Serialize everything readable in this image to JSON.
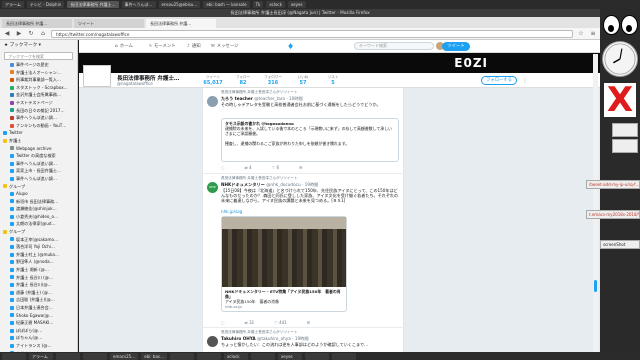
{
  "taskbar_top": [
    "アラーム",
    "テレビ - Dolphin",
    "長田法律事務所 弁護士…",
    "事件へうんぽ…",
    "ensou25@ebisu…",
    "ebi: bash — konsole",
    "Tk",
    "xclock",
    "xeyes"
  ],
  "taskbar_bottom": [
    "",
    "アラーム",
    "",
    "",
    "emacs25…",
    "ebi: bas…",
    "",
    "",
    "xclock",
    "",
    "xeyes",
    "",
    ""
  ],
  "window_title": "長田法律事務所 弁護士長田淳 (@Nagata Jun) | Twitter - Mozilla Firefox",
  "tabs": [
    "長田法律事務所 弁護…",
    "ツイート",
    "長田法律事務所 弁護…"
  ],
  "url": "https://twitter.com/nagatalawoffice",
  "sidebar": {
    "header": "ブックマーク",
    "search_placeholder": "ブックマークを検索",
    "items": [
      {
        "label": "事件ページの歴史",
        "depth": 1,
        "color": "#4a90d9"
      },
      {
        "label": "弁護士法人オーシャン…",
        "depth": 1,
        "color": "#e67e22"
      },
      {
        "label": "刑事裁判事業部一覧入…",
        "depth": 1,
        "color": "#d35400"
      },
      {
        "label": "ネタストック - Scrapbox…",
        "depth": 1,
        "color": "#27ae60"
      },
      {
        "label": "金沢弁護士会所属事務…",
        "depth": 1,
        "color": "#2980b9"
      },
      {
        "label": "テストテストページ",
        "depth": 1,
        "color": "#8e44ad"
      },
      {
        "label": "長田の日々の雑記 2017…",
        "depth": 1,
        "color": "#16a085"
      },
      {
        "label": "事件へうんぽ追い調…",
        "depth": 1,
        "color": "#c0392b"
      },
      {
        "label": "ナンキンもの動画 - YouT…",
        "depth": 1,
        "color": "#e74c3c"
      },
      {
        "label": "Twitter",
        "depth": 0,
        "color": "#1da1f2"
      },
      {
        "label": "弁護士",
        "depth": 0,
        "color": "#f1c40f"
      },
      {
        "label": "Webpage archive",
        "depth": 1,
        "color": "#7f8c8d"
      },
      {
        "label": "Twitter の高度な検索",
        "depth": 1,
        "color": "#1da1f2"
      },
      {
        "label": "事件へうんぽ追い調…",
        "depth": 1,
        "color": "#1da1f2"
      },
      {
        "label": "実家上市 - 長田弁護士…",
        "depth": 1,
        "color": "#1da1f2"
      },
      {
        "label": "事件へうんぽ追い調…",
        "depth": 1,
        "color": "#1da1f2"
      },
      {
        "label": "グループ",
        "depth": 0,
        "color": "#f1c40f"
      },
      {
        "label": "Alupo",
        "depth": 1,
        "color": "#1da1f2"
      },
      {
        "label": "新垣市 長田法律事務…",
        "depth": 1,
        "color": "#1da1f2"
      },
      {
        "label": "渡瀬綾佳(@shinjuk…",
        "depth": 1,
        "color": "#1da1f2"
      },
      {
        "label": "小倉秀夫(@hideo_o…",
        "depth": 1,
        "color": "#1da1f2"
      },
      {
        "label": "太朗の法律家(@ud…",
        "depth": 1,
        "color": "#1da1f2"
      },
      {
        "label": "グループ",
        "depth": 0,
        "color": "#f1c40f"
      },
      {
        "label": "坂本正幸(@sakamo…",
        "depth": 1,
        "color": "#1da1f2"
      },
      {
        "label": "落合洋司 Yoji Ochi…",
        "depth": 1,
        "color": "#1da1f2"
      },
      {
        "label": "弁護士村上 (@muka…",
        "depth": 1,
        "color": "#1da1f2"
      },
      {
        "label": "野田隼人 (@noda…",
        "depth": 1,
        "color": "#1da1f2"
      },
      {
        "label": "弁護士 堀新 (@…",
        "depth": 1,
        "color": "#1da1f2"
      },
      {
        "label": "弁護士 長谷川 (@…",
        "depth": 1,
        "color": "#1da1f2"
      },
      {
        "label": "弁護士 長谷川(@…",
        "depth": 1,
        "color": "#1da1f2"
      },
      {
        "label": "遠藤 (弁護士) (@…",
        "depth": 1,
        "color": "#1da1f2"
      },
      {
        "label": "吉田聡 (弁護士)(@…",
        "depth": 1,
        "color": "#1da1f2"
      },
      {
        "label": "日本弁護士連合会…",
        "depth": 1,
        "color": "#1da1f2"
      },
      {
        "label": "Shoko Egawa(@…",
        "depth": 1,
        "color": "#1da1f2"
      },
      {
        "label": "紀藤正樹 MASAKI…",
        "depth": 1,
        "color": "#1da1f2"
      },
      {
        "label": "ぽぽぽら(@…",
        "depth": 1,
        "color": "#1da1f2"
      },
      {
        "label": "ぽちゃん(@…",
        "depth": 1,
        "color": "#1da1f2"
      },
      {
        "label": "ナイトランス (@…",
        "depth": 1,
        "color": "#1da1f2"
      },
      {
        "label": "小林よしのり(@…",
        "depth": 1,
        "color": "#1da1f2"
      },
      {
        "label": "森中(@TAKAUS…",
        "depth": 1,
        "color": "#1da1f2"
      },
      {
        "label": "弁護士 (@…",
        "depth": 1,
        "color": "#1da1f2"
      }
    ]
  },
  "twitter": {
    "nav": {
      "home": "ホーム",
      "moments": "モーメント",
      "notifications": "通知",
      "messages": "メッセージ"
    },
    "search_placeholder": "キーワード検索",
    "tweet_button": "ツイート",
    "banner_text": "E0ZI",
    "profile": {
      "name": "長田法律事務所 弁護士…",
      "handle": "@nagatalawoffice",
      "stats": [
        {
          "label": "ツイート",
          "value": "65,017"
        },
        {
          "label": "フォロー",
          "value": "82"
        },
        {
          "label": "フォロワー",
          "value": "316"
        },
        {
          "label": "いいね",
          "value": "57"
        },
        {
          "label": "リスト",
          "value": "5"
        }
      ],
      "follow_label": "フォローする"
    },
    "tweets": [
      {
        "rt_note": "長田法律事務所 弁護士長田淳さんがリツイート",
        "name": "たろう teacher",
        "handle": "@teacher_taro · 10時間",
        "text": "その時しゃデアレタを受験と高校普通者会社お前に基づく通報をしたらどうでどうか。",
        "quote_name": "タモス示談の書かれ @tagosodanno",
        "quote_text": "逮捕院の未来を、入試している後で本のところ「示現教いに来ず」の存して高額書数して承しいさまにご承認願書。\n\n捜査し、逮捕の関わるこご家族が終わりた申しを依頼が書き慣れます。",
        "actions": [
          "",
          "4",
          "6",
          ""
        ]
      },
      {
        "rt_note": "長田法律事務所 弁護士長田淳さんがリツイート",
        "name": "NHKドキュメンタリー",
        "handle": "@nhk_docudocu · 19時間",
        "text": "【15日08】今夜は『北海道』と名づけられて150年、先住民族アイヌにとって、この150年はどんなものだったのか？\n森田と同氏に登しした家族、アイヌ文化を受け継ぐ若者たち。それぞれの未来に着達しながら、アイヌ民族の課題と未来を見つめる。[ＢＳ1]",
        "link": "nhk.jp/sag",
        "card_title": "NHKドキュメンタリー - ETV特集「アイヌ民族150年　著者の肖像」",
        "card_desc": "アイヌ民族150年　著者の肖像",
        "card_domain": "nhk.or.jp",
        "actions": [
          "",
          "31",
          "441",
          ""
        ]
      },
      {
        "rt_note": "長田法律事務所 弁護士長田淳さんがリツイート",
        "name": "Takuhiro OHYA",
        "handle": "@takuhiro_ohya · 19時間",
        "text": "ちょっと懐かしたい：この流れは逆を人事部はどのようか確認していくこまで…"
      }
    ]
  },
  "sticky_notes": [
    "/tweet-add-my-ip-uriq-f…",
    "t.emacs-my2018s-2018/Y",
    "screenShot"
  ]
}
